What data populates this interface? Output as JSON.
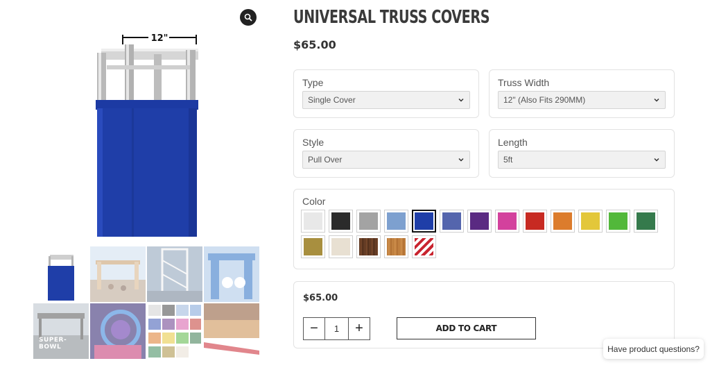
{
  "product": {
    "title": "UNIVERSAL TRUSS COVERS",
    "price": "$65.00",
    "image_dimension_label": "12\"",
    "thumbnail_caption": "SUPER-BOWL"
  },
  "options": {
    "type": {
      "label": "Type",
      "value": "Single Cover"
    },
    "truss_width": {
      "label": "Truss Width",
      "value": "12\" (Also Fits 290MM)"
    },
    "style": {
      "label": "Style",
      "value": "Pull Over"
    },
    "length": {
      "label": "Length",
      "value": "5ft"
    }
  },
  "color": {
    "label": "Color",
    "selected_index": 4,
    "swatches": [
      "#e8e8e8",
      "#2b2b2b",
      "#a3a3a3",
      "#7da0cf",
      "#1f3ea8",
      "#5465ad",
      "#5a2a82",
      "#d3419d",
      "#c72a22",
      "#dc7c2c",
      "#e3c73a",
      "#52b83a",
      "#357a4c",
      "#a88f3f",
      "#e8e0d2",
      "wood-dark",
      "wood-light",
      "stripes"
    ]
  },
  "purchase": {
    "price": "$65.00",
    "quantity": "1",
    "minus": "−",
    "plus": "+",
    "add_to_cart": "ADD TO CART"
  },
  "help": {
    "label": "Have product questions?"
  },
  "icons": {
    "zoom": "magnifier-icon",
    "chevron": "chevron-down-icon"
  },
  "colors": {
    "main_blue": "#1f3ea8",
    "text_dark": "#333333"
  }
}
